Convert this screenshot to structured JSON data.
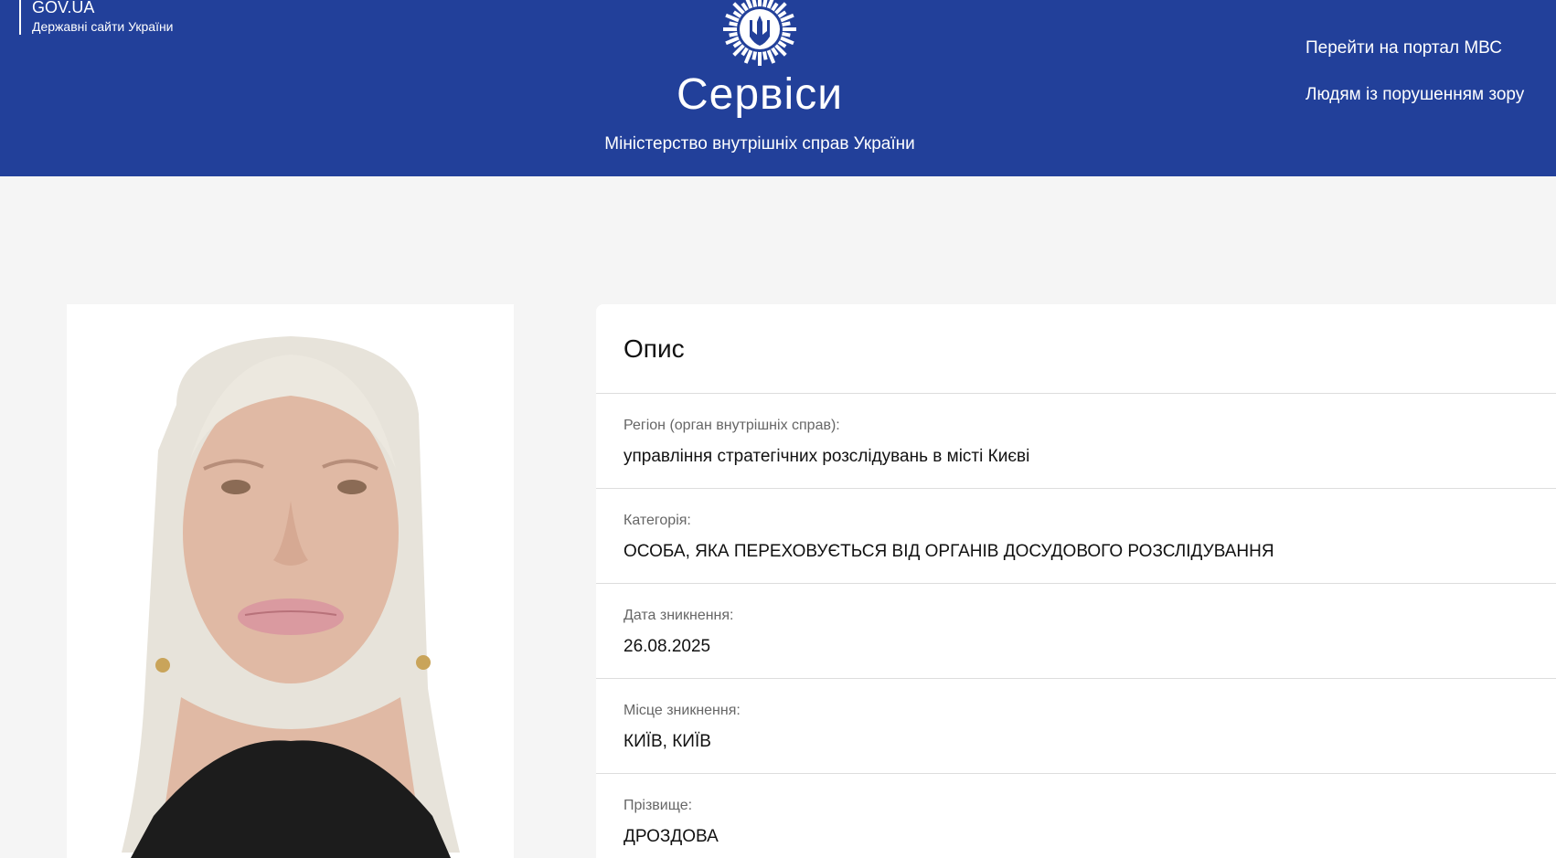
{
  "header": {
    "gov_title": "GOV.UA",
    "gov_subtitle": "Державні сайти України",
    "title": "Сервіси",
    "ministry": "Міністерство внутрішніх справ України",
    "links": [
      "Перейти на портал МВС",
      "Людям із порушенням зору"
    ],
    "emblem_icon": "police-star-emblem-icon",
    "background_color": "#22409a"
  },
  "description": {
    "title": "Опис",
    "fields": [
      {
        "label": "Регіон (орган внутрішніх справ):",
        "value": "управління стратегічних розслідувань в місті Києві"
      },
      {
        "label": "Категорія:",
        "value": "ОСОБА, ЯКА ПЕРЕХОВУЄТЬСЯ ВІД ОРГАНІВ ДОСУДОВОГО РОЗСЛІДУВАННЯ"
      },
      {
        "label": "Дата зникнення:",
        "value": "26.08.2025"
      },
      {
        "label": "Місце зникнення:",
        "value": "КИЇВ, КИЇВ"
      },
      {
        "label": "Прізвище:",
        "value": "ДРОЗДОВА"
      }
    ]
  }
}
